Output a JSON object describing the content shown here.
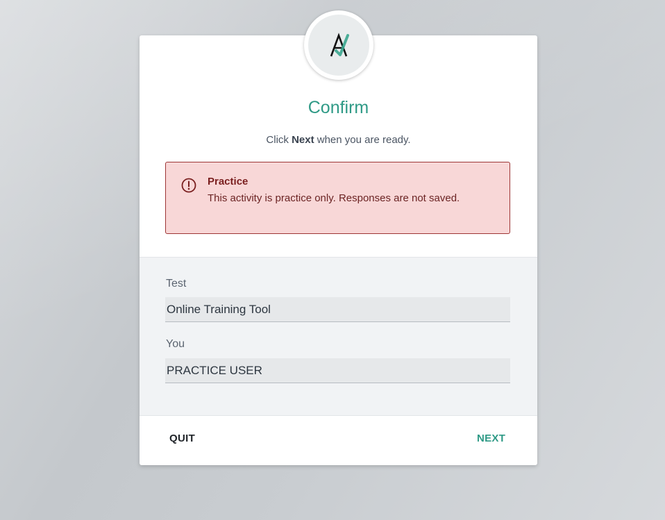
{
  "dialog": {
    "title": "Confirm",
    "subtitle_prefix": "Click ",
    "subtitle_bold": "Next",
    "subtitle_suffix": " when you are ready."
  },
  "alert": {
    "icon": "exclamation-circle-icon",
    "title": "Practice",
    "message": "This activity is practice only. Responses are not saved."
  },
  "fields": {
    "test_label": "Test",
    "test_value": "Online Training Tool",
    "user_label": "You",
    "user_value": "PRACTICE USER"
  },
  "footer": {
    "quit_label": "QUIT",
    "next_label": "NEXT"
  },
  "colors": {
    "accent": "#2f9a86",
    "alert_bg": "#f8d7d7",
    "alert_border": "#9d3434"
  }
}
